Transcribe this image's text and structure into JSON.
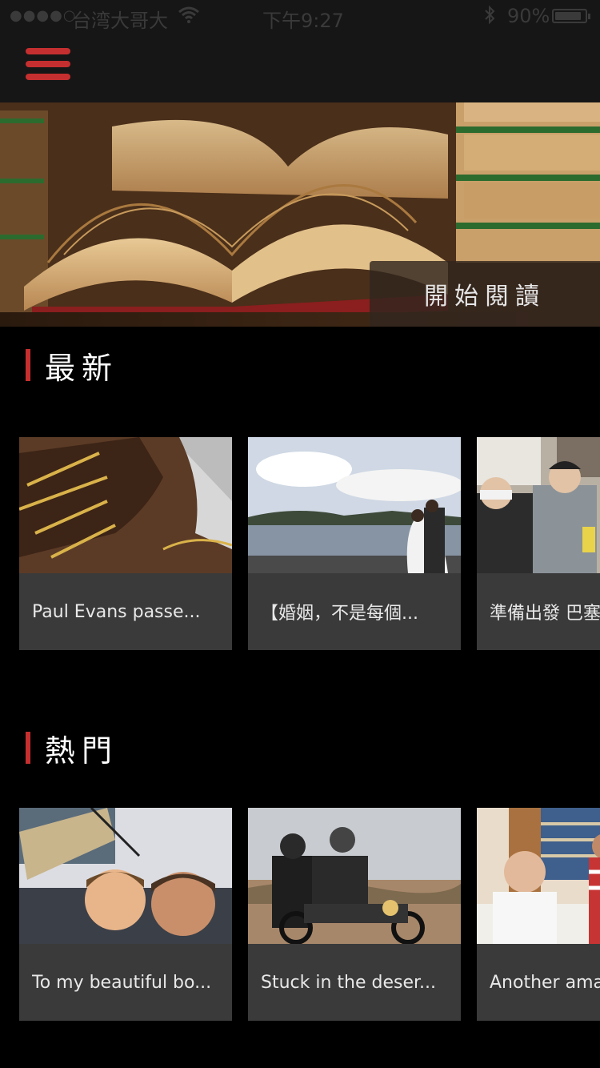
{
  "status_bar": {
    "signal": "●●●●○",
    "carrier": "台湾大哥大",
    "wifi_icon": "wifi-icon",
    "time": "下午9:27",
    "bluetooth_icon": "bluetooth-icon",
    "battery_percent": "90%",
    "battery_level": 0.9
  },
  "nav": {
    "menu_icon": "hamburger-menu-icon",
    "accent_color": "#c62f2f"
  },
  "hero": {
    "image": "open-books-banner",
    "button_label": "開始閱讀"
  },
  "sections": {
    "latest": {
      "title": "最新",
      "cards": [
        {
          "image": "boot-laces-photo",
          "caption": "Paul Evans passe..."
        },
        {
          "image": "wedding-couple-river-photo",
          "caption": "【婚姻，不是每個..."
        },
        {
          "image": "two-men-sitting-photo",
          "caption": "準備出發 巴塞"
        }
      ]
    },
    "popular": {
      "title": "熱門",
      "cards": [
        {
          "image": "father-son-selfie-photo",
          "caption": "To my beautiful bo..."
        },
        {
          "image": "motorcycle-desert-photo",
          "caption": "Stuck in the deser..."
        },
        {
          "image": "sushi-chef-photo",
          "caption": "Another ama"
        }
      ]
    }
  }
}
